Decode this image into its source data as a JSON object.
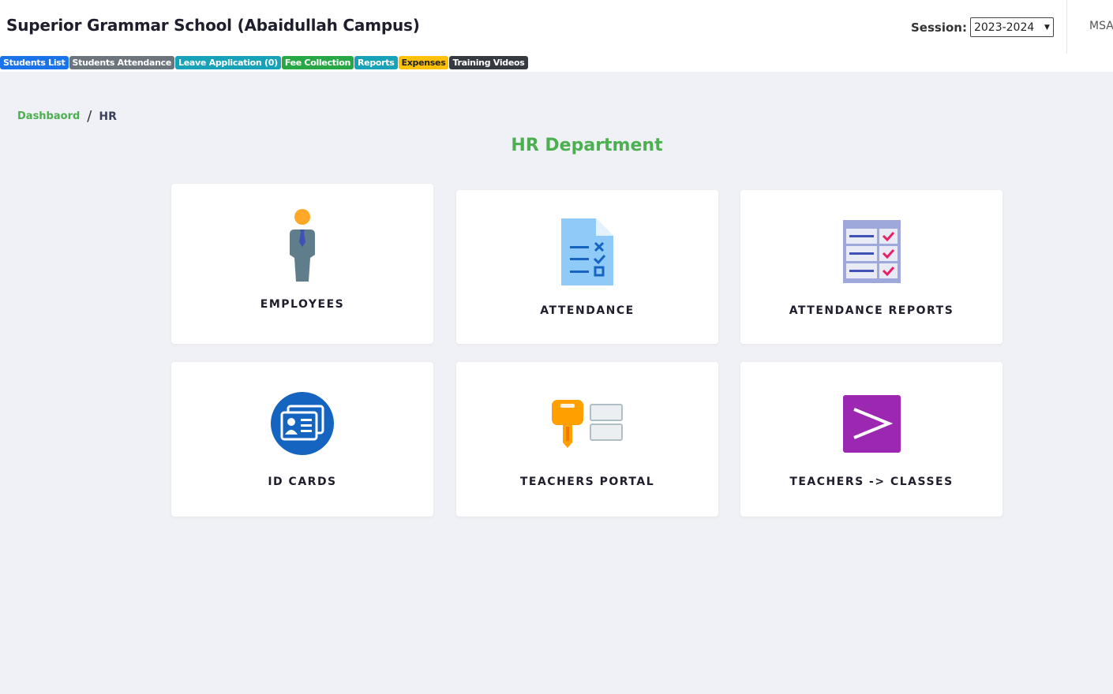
{
  "header": {
    "school_name": "Superior Grammar School (Abaidullah Campus)",
    "session_label": "Session:",
    "session_value": "2023-2024",
    "user_initials": "MSA"
  },
  "nav": [
    {
      "label": "Students List",
      "color": "#1a73e8"
    },
    {
      "label": "Students Attendance",
      "color": "#6c757d"
    },
    {
      "label": "Leave Application (0)",
      "color": "#17a2b8"
    },
    {
      "label": "Fee Collection",
      "color": "#28a745"
    },
    {
      "label": "Reports",
      "color": "#17a2b8"
    },
    {
      "label": "Expenses",
      "color": "#ffc107"
    },
    {
      "label": "Training Videos",
      "color": "#343a40"
    }
  ],
  "breadcrumb": {
    "home": "Dashbaord",
    "separator": "/",
    "current": "HR"
  },
  "page_title": "HR Department",
  "cards": [
    {
      "label": "EMPLOYEES",
      "icon": "employee-icon"
    },
    {
      "label": "ATTENDANCE",
      "icon": "attendance-checklist-icon"
    },
    {
      "label": "ATTENDANCE REPORTS",
      "icon": "attendance-report-icon"
    },
    {
      "label": "ID CARDS",
      "icon": "id-card-icon"
    },
    {
      "label": "TEACHERS PORTAL",
      "icon": "key-portal-icon"
    },
    {
      "label": "TEACHERS -> CLASSES",
      "icon": "arrow-right-icon"
    }
  ],
  "colors": {
    "accent_green": "#4caf50",
    "header_bg": "#ffffff",
    "page_bg": "#f0f1f6"
  }
}
